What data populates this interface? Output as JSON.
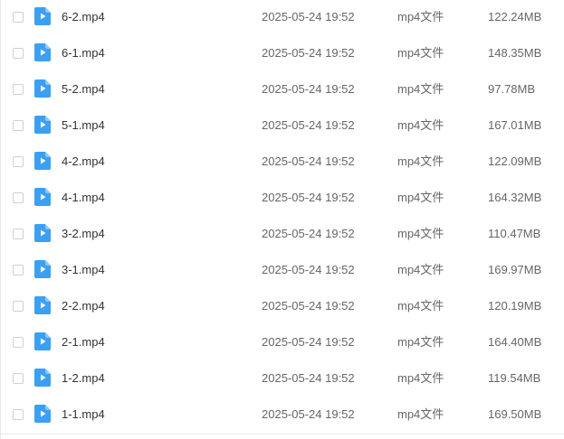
{
  "file_list": {
    "icon": "video-file-icon",
    "icon_color": "#3aa0f5",
    "rows": [
      {
        "name": "6-2.mp4",
        "modified": "2025-05-24 19:52",
        "type": "mp4文件",
        "size": "122.24MB"
      },
      {
        "name": "6-1.mp4",
        "modified": "2025-05-24 19:52",
        "type": "mp4文件",
        "size": "148.35MB"
      },
      {
        "name": "5-2.mp4",
        "modified": "2025-05-24 19:52",
        "type": "mp4文件",
        "size": "97.78MB"
      },
      {
        "name": "5-1.mp4",
        "modified": "2025-05-24 19:52",
        "type": "mp4文件",
        "size": "167.01MB"
      },
      {
        "name": "4-2.mp4",
        "modified": "2025-05-24 19:52",
        "type": "mp4文件",
        "size": "122.09MB"
      },
      {
        "name": "4-1.mp4",
        "modified": "2025-05-24 19:52",
        "type": "mp4文件",
        "size": "164.32MB"
      },
      {
        "name": "3-2.mp4",
        "modified": "2025-05-24 19:52",
        "type": "mp4文件",
        "size": "110.47MB"
      },
      {
        "name": "3-1.mp4",
        "modified": "2025-05-24 19:52",
        "type": "mp4文件",
        "size": "169.97MB"
      },
      {
        "name": "2-2.mp4",
        "modified": "2025-05-24 19:52",
        "type": "mp4文件",
        "size": "120.19MB"
      },
      {
        "name": "2-1.mp4",
        "modified": "2025-05-24 19:52",
        "type": "mp4文件",
        "size": "164.40MB"
      },
      {
        "name": "1-2.mp4",
        "modified": "2025-05-24 19:52",
        "type": "mp4文件",
        "size": "119.54MB"
      },
      {
        "name": "1-1.mp4",
        "modified": "2025-05-24 19:52",
        "type": "mp4文件",
        "size": "169.50MB"
      }
    ]
  }
}
